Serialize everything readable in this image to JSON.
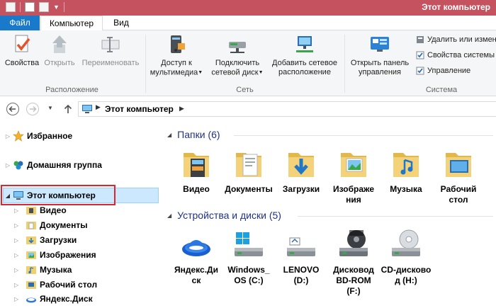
{
  "window": {
    "title": "Этот компьютер"
  },
  "ribbon_tabs": {
    "file": "Файл",
    "computer": "Компьютер",
    "view": "Вид"
  },
  "ribbon": {
    "location": {
      "label": "Расположение",
      "properties": "Свойства",
      "open": "Открыть",
      "rename": "Переименовать"
    },
    "network": {
      "label": "Сеть",
      "media": [
        "Доступ к",
        "мультимедиа"
      ],
      "map_drive": [
        "Подключить",
        "сетевой диск"
      ],
      "add_location": [
        "Добавить сетевое",
        "расположение"
      ]
    },
    "system": {
      "label": "Система",
      "control_panel": [
        "Открыть панель",
        "управления"
      ],
      "uninstall": "Удалить или измен",
      "sys_props": "Свойства системы",
      "manage": "Управление"
    }
  },
  "address": {
    "location": "Этот компьютер"
  },
  "nav": {
    "favorites": "Избранное",
    "homegroup": "Домашняя группа",
    "this_pc": "Этот компьютер",
    "children": [
      "Видео",
      "Документы",
      "Загрузки",
      "Изображения",
      "Музыка",
      "Рабочий стол",
      "Яндекс.Диск"
    ]
  },
  "folders": {
    "header": "Папки (6)",
    "items": [
      {
        "name": [
          "Видео"
        ]
      },
      {
        "name": [
          "Документы",
          ""
        ]
      },
      {
        "name": [
          "Загрузки"
        ]
      },
      {
        "name": [
          "Изображе",
          "ния"
        ]
      },
      {
        "name": [
          "Музыка"
        ]
      },
      {
        "name": [
          "Рабочий",
          "стол"
        ]
      }
    ]
  },
  "devices": {
    "header": "Устройства и диски (5)",
    "items": [
      {
        "name": [
          "Яндекс.Ди",
          "ск"
        ]
      },
      {
        "name": [
          "Windows_",
          "OS (C:)"
        ]
      },
      {
        "name": [
          "LENOVO",
          "(D:)"
        ]
      },
      {
        "name": [
          "Дисковод",
          "BD-ROM",
          "(F:)"
        ]
      },
      {
        "name": [
          "CD-дисково",
          "д (H:)"
        ]
      }
    ]
  },
  "colors": {
    "titlebar": "#c4525f",
    "file_tab": "#1979ca",
    "header_text": "#1e3287",
    "selection": "#cce8ff",
    "highlight_box": "#e2232b"
  }
}
